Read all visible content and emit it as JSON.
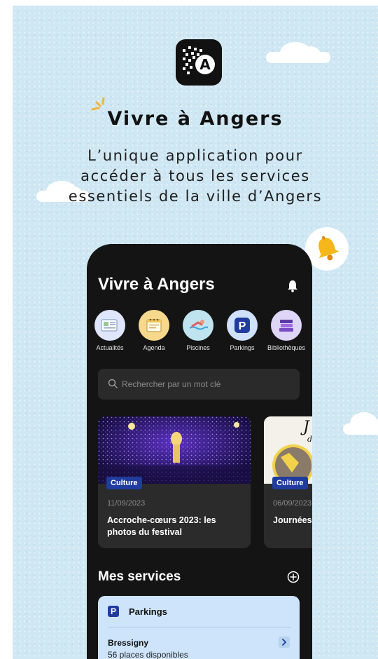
{
  "colors": {
    "background": "#cfe7f3",
    "phone": "#141414",
    "accent_blue": "#1f3c9e",
    "service_card": "#cde4fb",
    "bell_yellow": "#f5b71a"
  },
  "promo": {
    "logo_letter": "A",
    "headline": "Vivre à Angers",
    "tagline": "L’unique application pour\naccéder à tous les services\nessentiels de la ville d’Angers"
  },
  "app": {
    "title": "Vivre à Angers",
    "bell_icon": "bell-icon",
    "shortcuts": [
      {
        "label": "Actualités",
        "icon": "newspaper-icon",
        "color": "#dfe6fb"
      },
      {
        "label": "Agenda",
        "icon": "notepad-icon",
        "color": "#f7d98d"
      },
      {
        "label": "Piscines",
        "icon": "swimmer-icon",
        "color": "#bfe4f0"
      },
      {
        "label": "Parkings",
        "icon": "parking-icon",
        "color": "#cfe1fb"
      },
      {
        "label": "Bibliothèques",
        "icon": "books-icon",
        "color": "#ddd6f7"
      }
    ],
    "search": {
      "placeholder": "Rechercher par un mot clé",
      "value": ""
    },
    "news": [
      {
        "tag": "Culture",
        "date": "11/09/2023",
        "title": "Accroche-cœurs 2023: les photos du festival"
      },
      {
        "tag": "Culture",
        "date": "06/09/2023",
        "title": "Journées du patrimoine"
      }
    ],
    "services": {
      "heading": "Mes services",
      "add_icon": "plus-circle-icon",
      "card": {
        "icon_letter": "P",
        "name": "Parkings",
        "lot_name": "Bressigny",
        "lot_status": "56 places disponibles"
      }
    }
  }
}
